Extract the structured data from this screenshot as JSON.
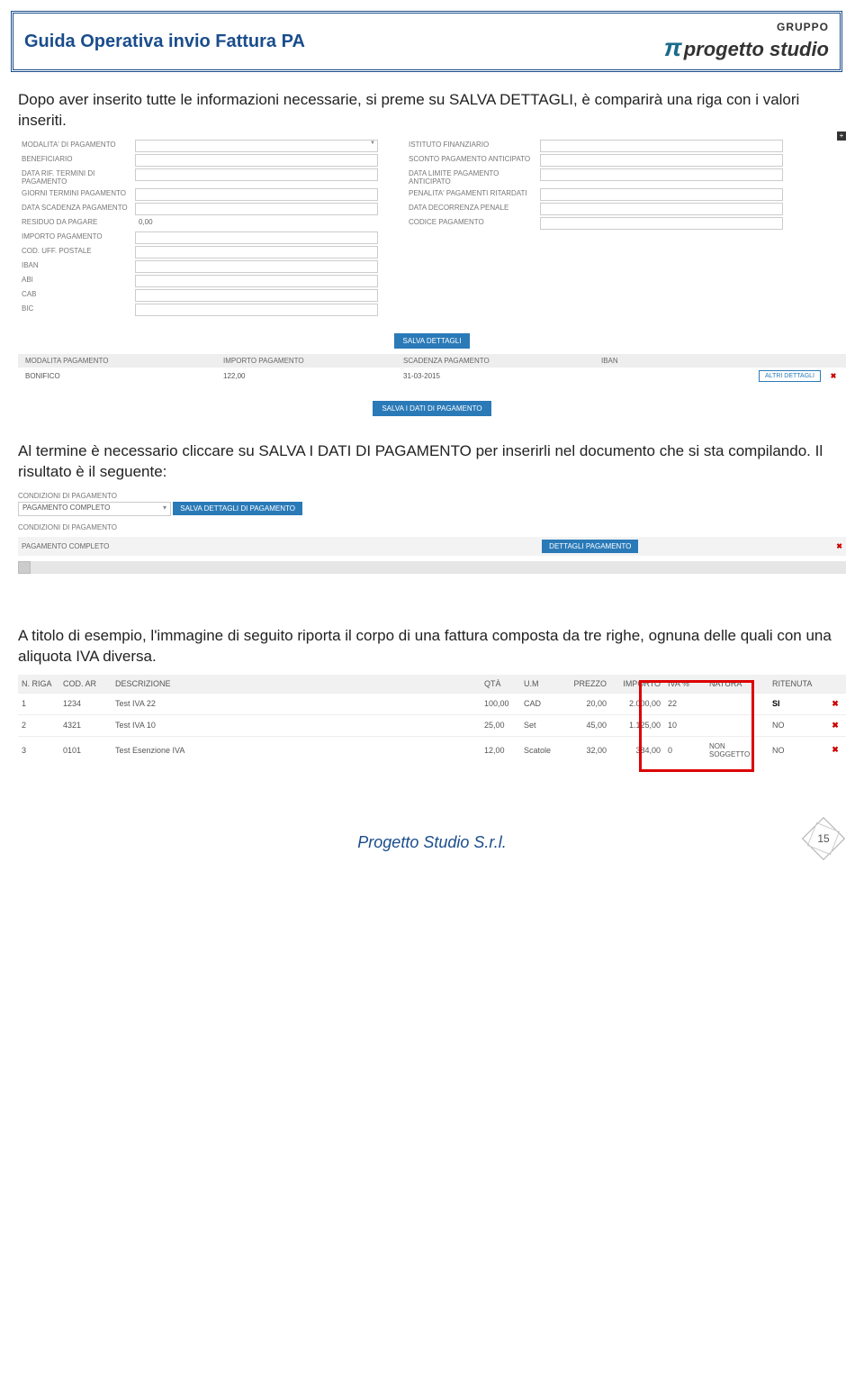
{
  "header": {
    "title": "Guida Operativa invio Fattura PA",
    "logo_gruppo": "GRUPPO",
    "logo_text": "progetto studio",
    "logo_pi": "π"
  },
  "para1": "Dopo aver inserito tutte le informazioni necessarie, si preme su SALVA DETTAGLI, è comparirà una riga con i valori inseriti.",
  "shot1": {
    "left_labels": [
      "MODALITA' DI PAGAMENTO",
      "BENEFICIARIO",
      "DATA RIF. TERMINI DI PAGAMENTO",
      "GIORNI TERMINI PAGAMENTO",
      "DATA SCADENZA PAGAMENTO",
      "RESIDUO DA PAGARE",
      "IMPORTO PAGAMENTO",
      "COD. UFF. POSTALE",
      "IBAN",
      "ABI",
      "CAB",
      "BIC"
    ],
    "right_labels": [
      "ISTITUTO FINANZIARIO",
      "SCONTO PAGAMENTO ANTICIPATO",
      "DATA LIMITE PAGAMENTO ANTICIPATO",
      "PENALITA' PAGAMENTI RITARDATI",
      "DATA DECORRENZA PENALE",
      "CODICE PAGAMENTO"
    ],
    "residuo": "0,00",
    "btn_salva_dettagli": "SALVA DETTAGLI",
    "btn_salva_dati": "SALVA I DATI DI PAGAMENTO",
    "btn_altri": "ALTRI DETTAGLI",
    "plus": "+",
    "thead": {
      "modalita": "MODALITA PAGAMENTO",
      "importo": "IMPORTO PAGAMENTO",
      "scadenza": "SCADENZA PAGAMENTO",
      "iban": "IBAN"
    },
    "trow": {
      "modalita": "BONIFICO",
      "importo": "122,00",
      "scadenza": "31-03-2015"
    }
  },
  "para2": "Al termine è necessario cliccare su SALVA I DATI DI PAGAMENTO per inserirli nel documento che si sta compilando. Il risultato è il seguente:",
  "shot2": {
    "lbl_cond": "CONDIZIONI DI PAGAMENTO",
    "sel_val": "PAGAMENTO COMPLETO",
    "btn_salva": "SALVA DETTAGLI DI PAGAMENTO",
    "row_text": "PAGAMENTO COMPLETO",
    "btn_dettagli": "DETTAGLI PAGAMENTO"
  },
  "para3": "A titolo di esempio, l'immagine di seguito riporta il corpo di una fattura composta da tre righe, ognuna delle quali con una aliquota IVA diversa.",
  "shot3": {
    "headers": [
      "N. RIGA",
      "COD. AR",
      "DESCRIZIONE",
      "QTÀ",
      "U.M",
      "PREZZO",
      "IMPORTO",
      "IVA %",
      "NATURA",
      "RITENUTA"
    ],
    "rows": [
      {
        "n": "1",
        "cod": "1234",
        "desc": "Test IVA 22",
        "qta": "100,00",
        "um": "CAD",
        "prezzo": "20,00",
        "imp": "2.000,00",
        "iva": "22",
        "nat": "",
        "rit": "SI"
      },
      {
        "n": "2",
        "cod": "4321",
        "desc": "Test IVA 10",
        "qta": "25,00",
        "um": "Set",
        "prezzo": "45,00",
        "imp": "1.125,00",
        "iva": "10",
        "nat": "",
        "rit": "NO"
      },
      {
        "n": "3",
        "cod": "0101",
        "desc": "Test Esenzione IVA",
        "qta": "12,00",
        "um": "Scatole",
        "prezzo": "32,00",
        "imp": "384,00",
        "iva": "0",
        "nat": "NON SOGGETTO",
        "rit": "NO"
      }
    ]
  },
  "footer": {
    "company": "Progetto Studio S.r.l.",
    "page": "15"
  }
}
